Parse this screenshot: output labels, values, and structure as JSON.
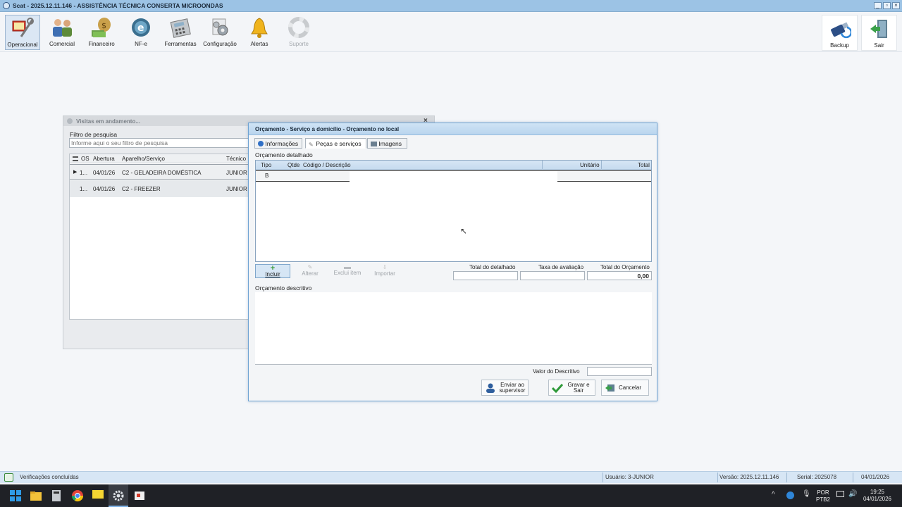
{
  "titlebar": {
    "title": "Scat - 2025.12.11.146 - ASSISTÊNCIA TÉCNICA CONSERTA MICROONDAS"
  },
  "ribbon": {
    "items": [
      {
        "label": "Operacional",
        "icon": "operacional-icon"
      },
      {
        "label": "Comercial",
        "icon": "people-icon"
      },
      {
        "label": "Financeiro",
        "icon": "money-icon"
      },
      {
        "label": "NF-e",
        "icon": "globe-icon"
      },
      {
        "label": "Ferramentas",
        "icon": "calculator-icon"
      },
      {
        "label": "Configuração",
        "icon": "gears-icon"
      },
      {
        "label": "Alertas",
        "icon": "bell-icon"
      },
      {
        "label": "Suporte",
        "icon": "lifebuoy-icon"
      }
    ],
    "right": [
      {
        "label": "Backup",
        "icon": "usb-drive-icon"
      },
      {
        "label": "Sair",
        "icon": "exit-door-icon"
      }
    ]
  },
  "visits": {
    "title": "Visitas em andamento...",
    "filter_label": "Filtro de pesquisa",
    "filter_placeholder": "Informe aqui o seu filtro de pesquisa",
    "columns": {
      "os": "OS",
      "abertura": "Abertura",
      "aparelho": "Aparelho/Serviço",
      "tecnico": "Técnico"
    },
    "rows": [
      {
        "os": "1...",
        "abertura": "04/01/26",
        "aparelho": "C2 - GELADEIRA DOMÉSTICA",
        "tecnico": "JUNIOR"
      },
      {
        "os": "1...",
        "abertura": "04/01/26",
        "aparelho": "C2 - FREEZER",
        "tecnico": "JUNIOR"
      }
    ]
  },
  "dialog": {
    "title": "Orçamento - Serviço a domicílio - Orçamento no local",
    "tabs": [
      "Informações",
      "Peças e serviços",
      "Imagens"
    ],
    "detalhado_label": "Orçamento detalhado",
    "columns": {
      "tipo": "Tipo",
      "qtde": "Qtde",
      "codigo": "Código / Descrição",
      "unitario": "Unitário",
      "total": "Total"
    },
    "row_tipo": "B",
    "tools": [
      "Incluir",
      "Alterar",
      "Exclui item",
      "Importar"
    ],
    "total_detalhado_label": "Total do detalhado",
    "taxa_label": "Taxa de avaliação",
    "total_orcamento_label": "Total do Orçamento",
    "total_detalhado_value": "",
    "taxa_value": "",
    "total_orcamento_value": "0,00",
    "descritivo_label": "Orçamento descritivo",
    "valor_descritivo_label": "Valor do Descritivo",
    "valor_descritivo_value": "",
    "buttons": {
      "supervisor": "Enviar ao supervisor",
      "supervisor_l1": "Enviar ao",
      "supervisor_l2": "supervisor",
      "gravar_l1": "Gravar e",
      "gravar_l2": "Sair",
      "cancelar": "Cancelar"
    }
  },
  "status": {
    "message": "Verificações concluídas",
    "usuario": "Usuário: 3-JUNIOR",
    "versao": "Versão: 2025.12.11.146",
    "serial": "Serial: 2025078",
    "data": "04/01/2026"
  },
  "taskbar": {
    "lang1": "POR",
    "lang2": "PTB2",
    "time": "19:25",
    "date": "04/01/2026"
  },
  "colors": {
    "accent": "#9cc3e5",
    "dialog_border": "#6fa3d3",
    "taskbar": "#1f2126"
  }
}
